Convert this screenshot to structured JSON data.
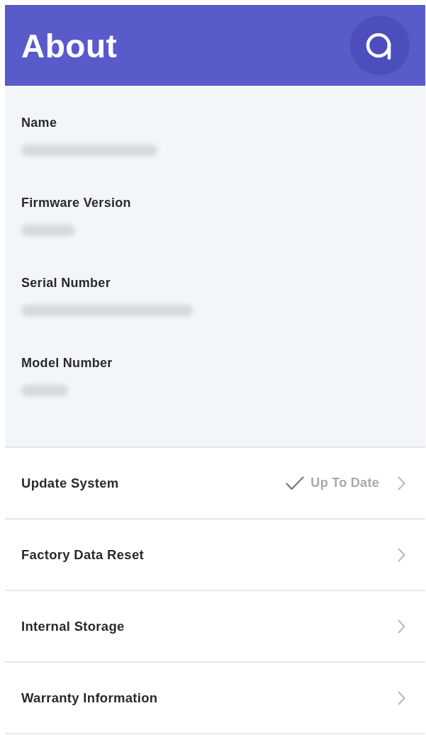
{
  "header": {
    "title": "About"
  },
  "info_fields": [
    {
      "label": "Name"
    },
    {
      "label": "Firmware Version"
    },
    {
      "label": "Serial Number"
    },
    {
      "label": "Model Number"
    }
  ],
  "menu_rows": [
    {
      "label": "Update System",
      "status": "Up To Date"
    },
    {
      "label": "Factory Data Reset"
    },
    {
      "label": "Internal Storage"
    },
    {
      "label": "Warranty Information"
    }
  ]
}
